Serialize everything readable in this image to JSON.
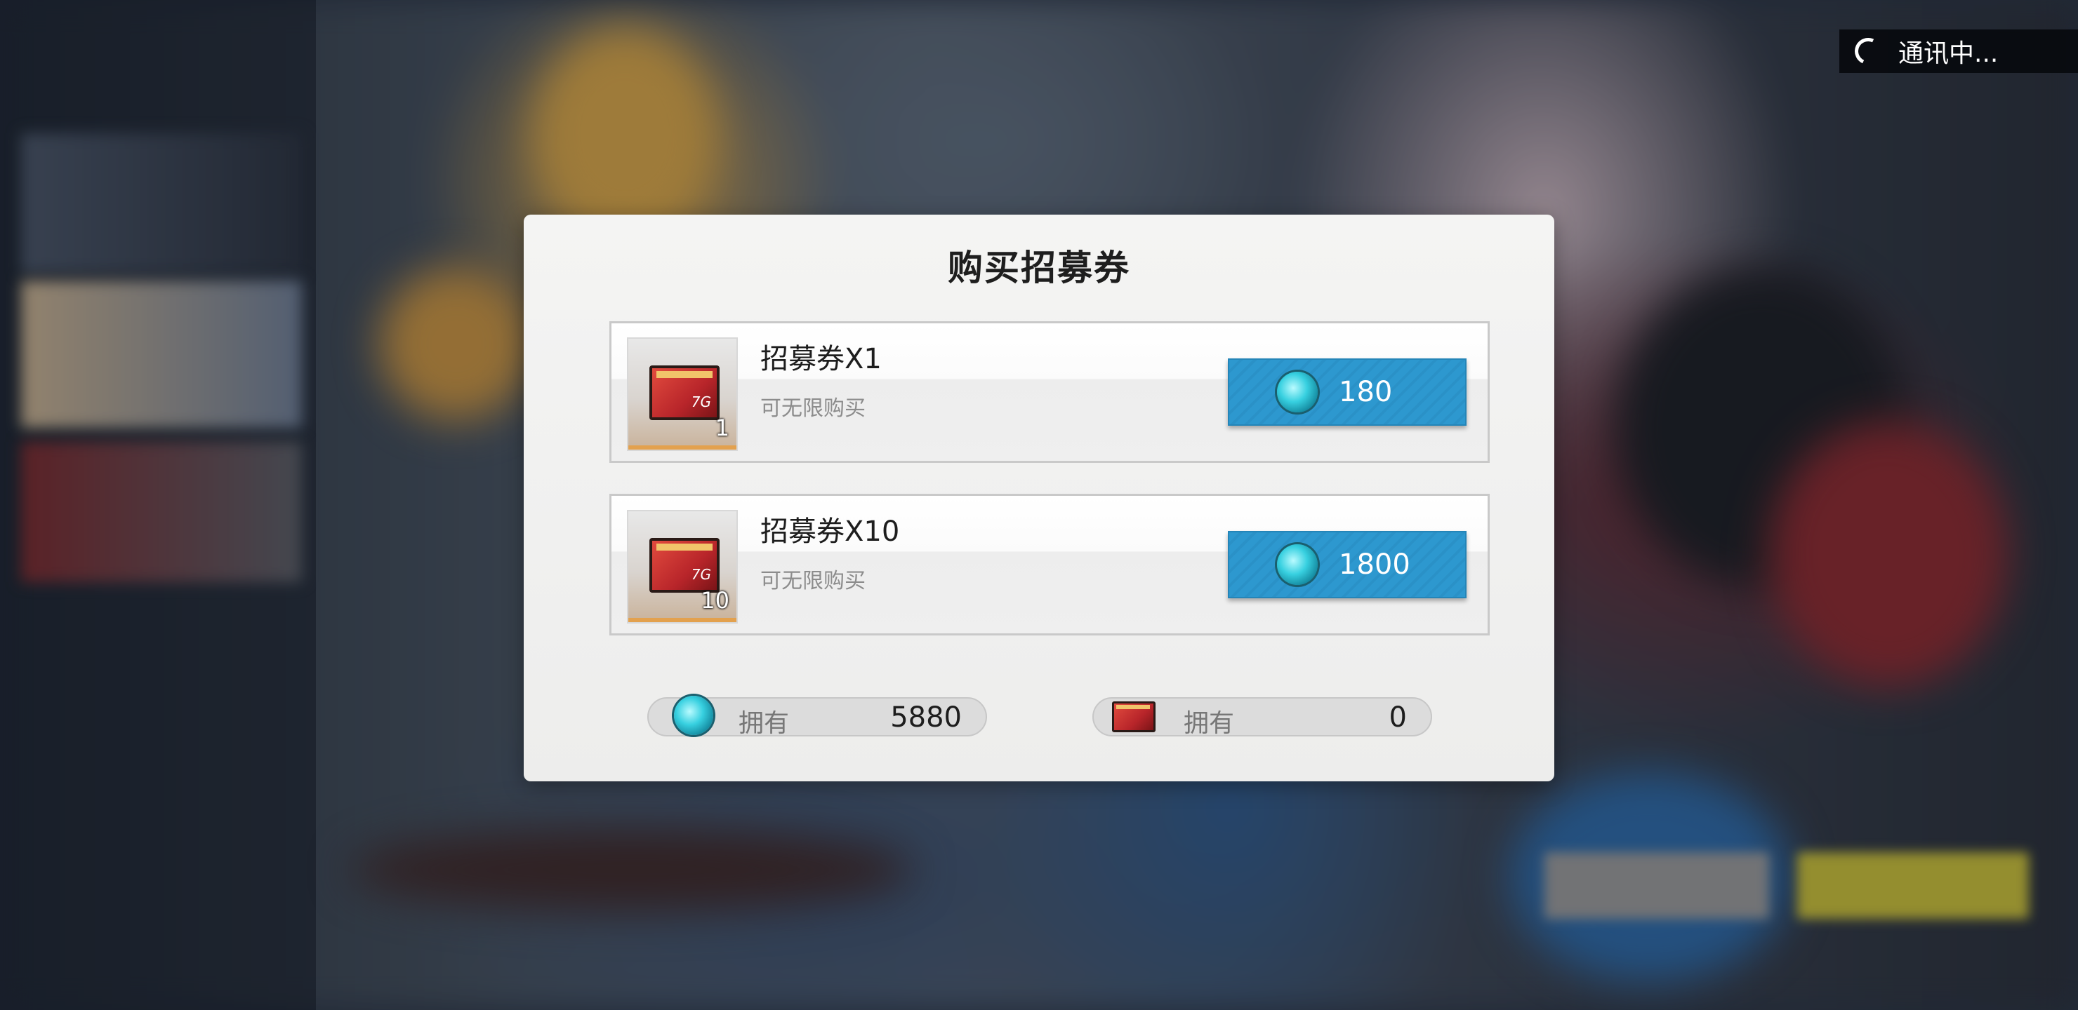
{
  "status": {
    "text": "通讯中..."
  },
  "dialog": {
    "title": "购买招募券",
    "items": [
      {
        "name": "招募券X1",
        "note": "可无限购买",
        "quantity": "1",
        "price": "180"
      },
      {
        "name": "招募券X10",
        "note": "可无限购买",
        "quantity": "10",
        "price": "1800"
      }
    ],
    "owned": [
      {
        "label": "拥有",
        "value": "5880",
        "icon": "gem-icon"
      },
      {
        "label": "拥有",
        "value": "0",
        "icon": "recruit-ticket-icon"
      }
    ]
  },
  "colors": {
    "buy_button": "#2d98cf",
    "dialog_bg": "#f1f1f0",
    "gem": "#37d0e0",
    "ticket": "#c8302e"
  }
}
